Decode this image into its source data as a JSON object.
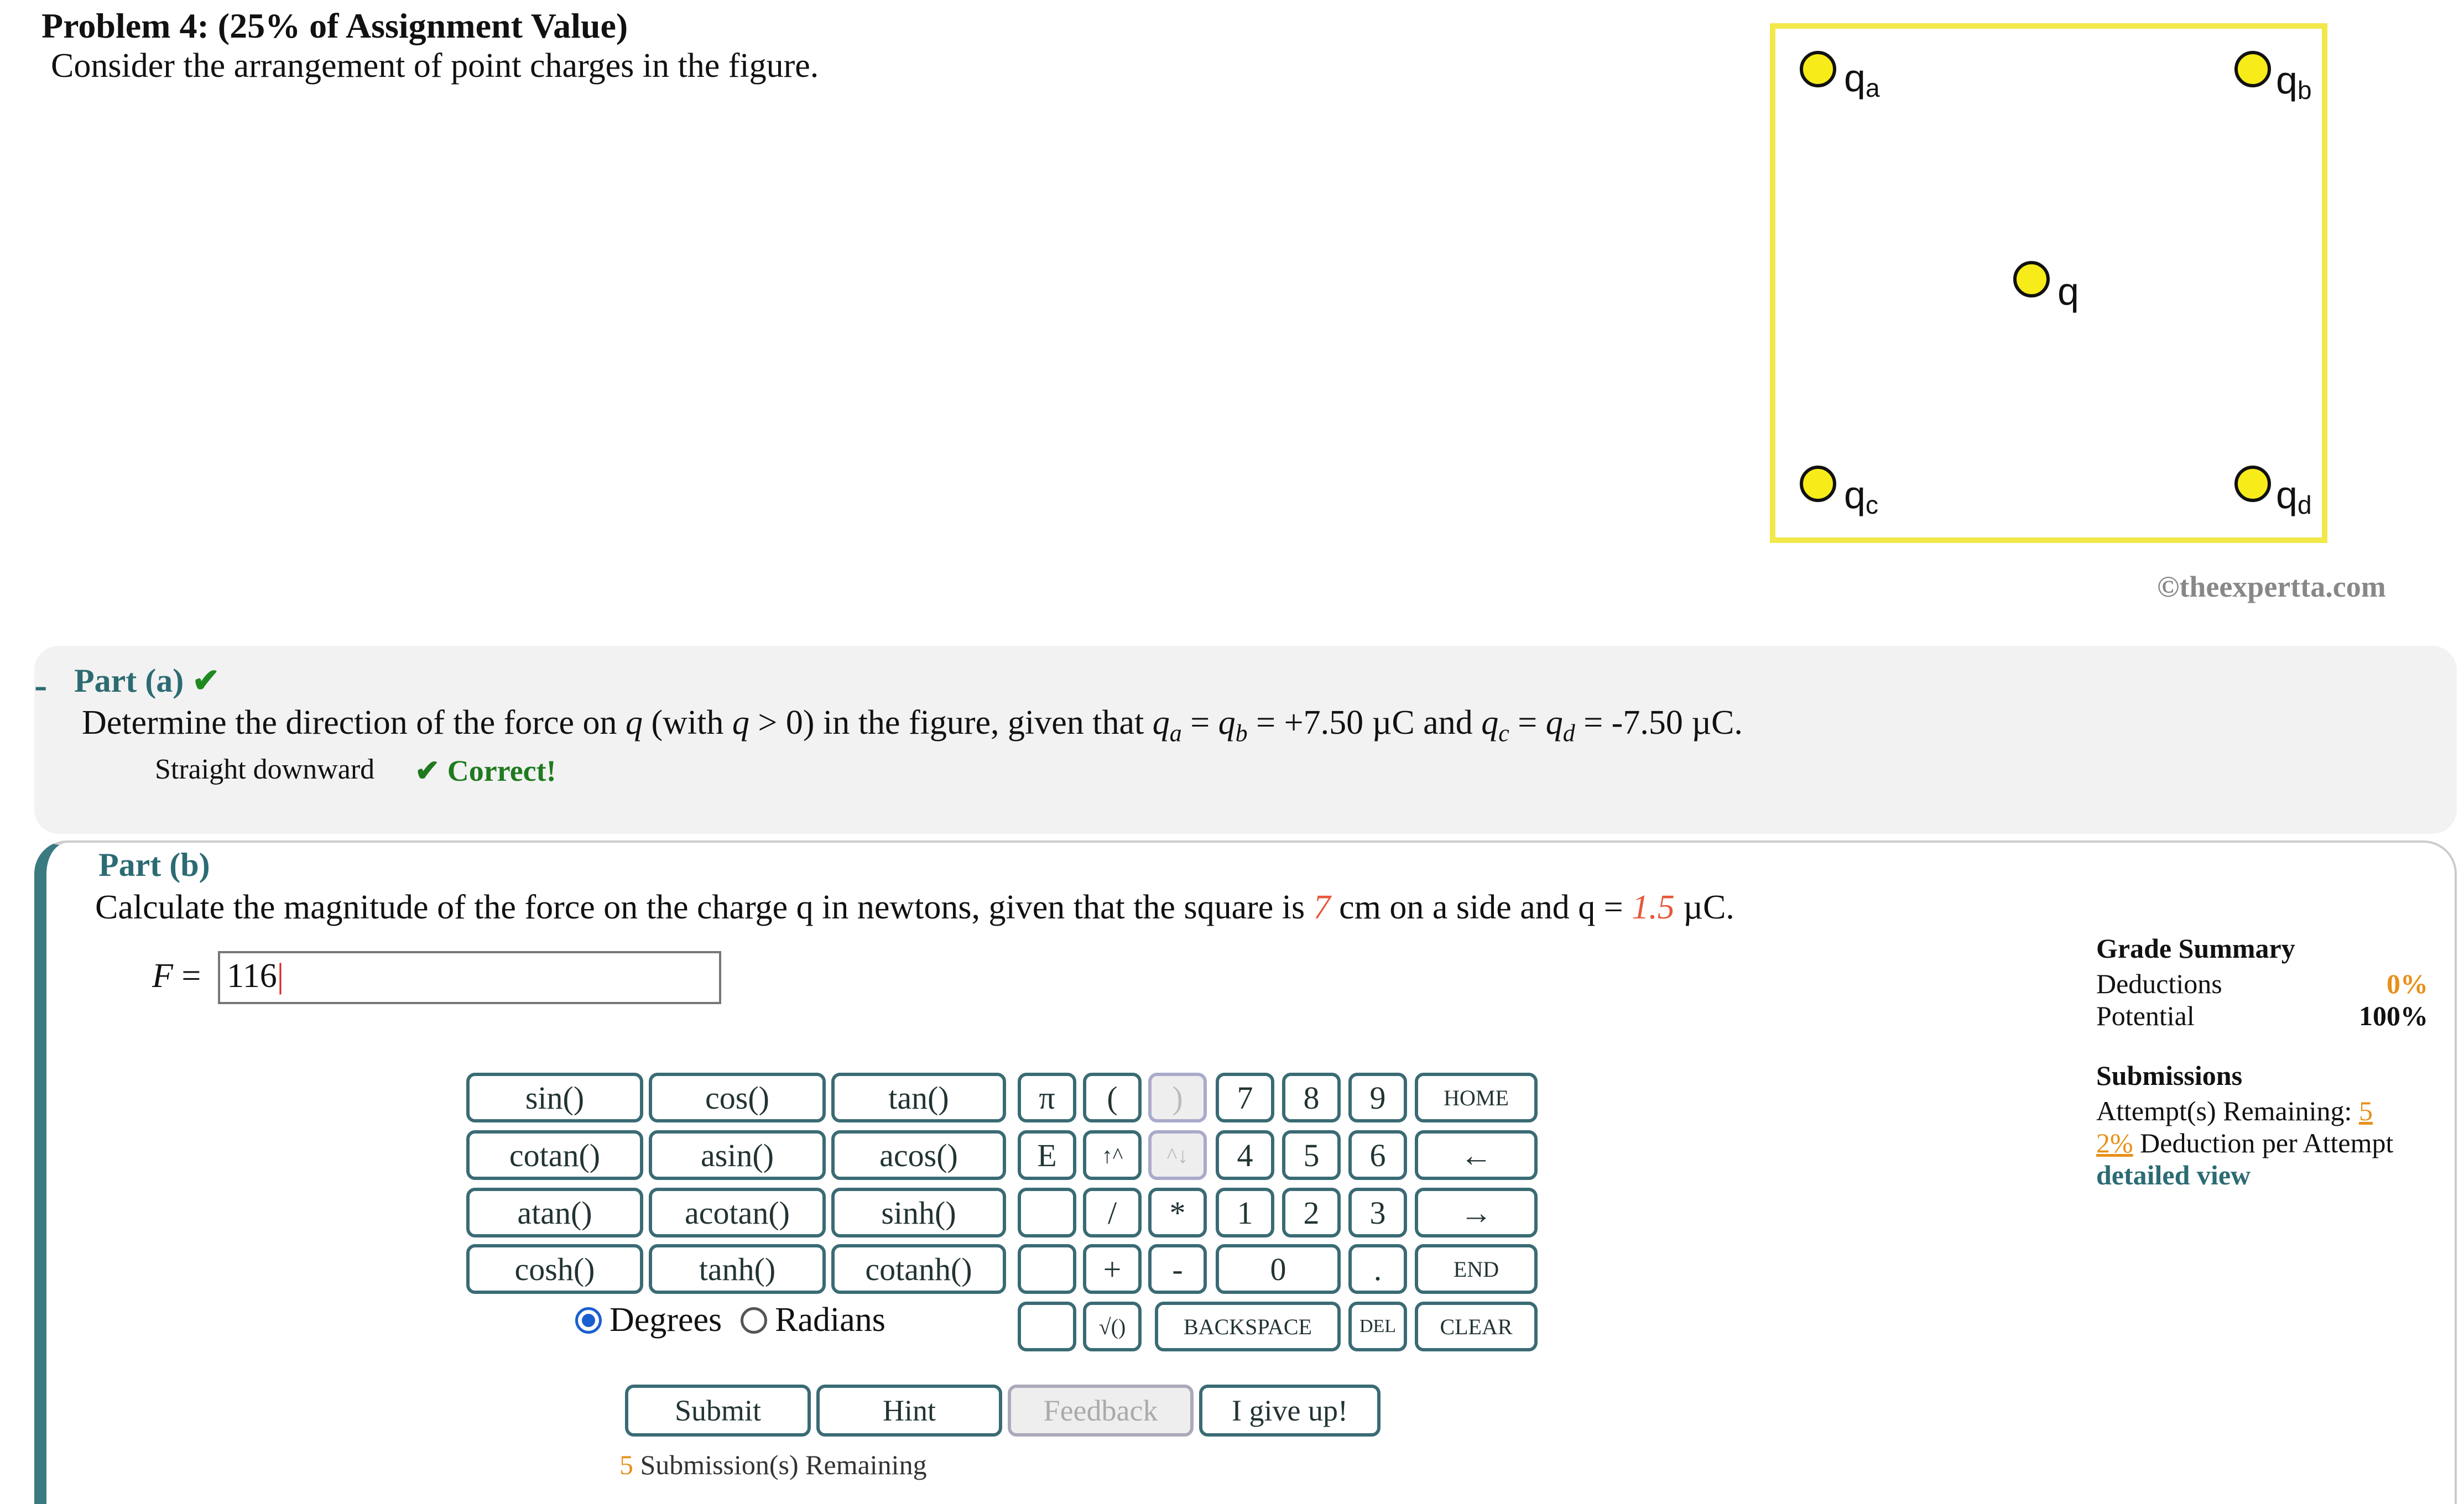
{
  "problem": {
    "title": "Problem 4: (25% of Assignment Value)",
    "intro": "Consider the arrangement of point charges in the figure."
  },
  "figure": {
    "labels": {
      "qa": "a",
      "qb": "b",
      "q": "q",
      "qc": "c",
      "qd": "d"
    },
    "watermark": "©theexpertta.com",
    "colors": {
      "border": "#f2e84a",
      "charge": "#f7ec1a"
    }
  },
  "part_a": {
    "title": "Part (a)",
    "collapse": "-",
    "check": "✔",
    "question_prefix": "Determine the direction of the force on ",
    "question_mid": " (with ",
    "question_mid2": " > 0) in the figure, given that ",
    "question_eq1": " = ",
    "question_eq2": " = +7.50 µC and ",
    "question_eq3": " = ",
    "question_eq4": " = -7.50 µC.",
    "answer": "Straight downward",
    "feedback": "✔ Correct!"
  },
  "part_b": {
    "title": "Part (b)",
    "question_prefix": "Calculate the magnitude of the force on the charge q in newtons, given that the square is ",
    "side": "7",
    "question_mid": " cm on a side and q = ",
    "charge": "1.5",
    "question_suffix": " µC.",
    "answer_label": "F",
    "answer_eq": " = ",
    "answer_value": "116"
  },
  "keypad": {
    "functions": [
      "sin()",
      "cos()",
      "tan()",
      "cotan()",
      "asin()",
      "acos()",
      "atan()",
      "acotan()",
      "sinh()",
      "cosh()",
      "tanh()",
      "cotanh()"
    ],
    "pi": "π",
    "lparen": "(",
    "rparen": ")",
    "e": "E",
    "up": "↑^",
    "down": "^↓",
    "slash": "/",
    "star": "*",
    "plus": "+",
    "minus": "-",
    "sqrt": "√()",
    "digits": [
      "7",
      "8",
      "9",
      "4",
      "5",
      "6",
      "1",
      "2",
      "3",
      "0",
      "."
    ],
    "home": "HOME",
    "left": "←",
    "right": "→",
    "end": "END",
    "backspace": "BACKSPACE",
    "del": "DEL",
    "clear": "CLEAR",
    "degrees": "Degrees",
    "radians": "Radians"
  },
  "actions": {
    "submit": "Submit",
    "hint": "Hint",
    "feedback": "Feedback",
    "give_up": "I give up!"
  },
  "submissions_note": {
    "count": "5",
    "text": " Submission(s) Remaining"
  },
  "grade_summary": {
    "title": "Grade Summary",
    "deductions_label": "Deductions",
    "deductions_value": "0%",
    "potential_label": "Potential",
    "potential_value": "100%",
    "submissions_title": "Submissions",
    "attempts_label": "Attempt(s) Remaining: ",
    "attempts_value": "5",
    "deduction_value": "2%",
    "deduction_label": " Deduction per Attempt",
    "detailed_view": "detailed view"
  }
}
